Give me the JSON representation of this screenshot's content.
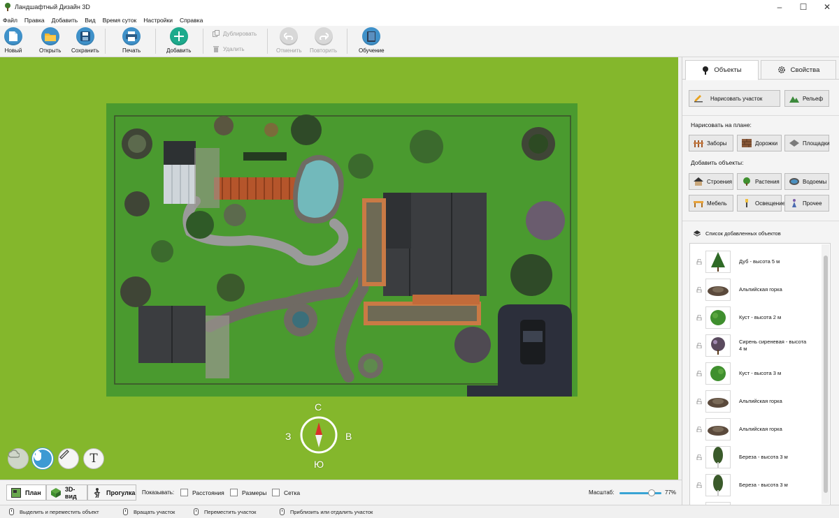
{
  "window": {
    "title": "Ландшафтный Дизайн 3D",
    "controls": [
      "–",
      "☐",
      "✕"
    ]
  },
  "menu": [
    "Файл",
    "Правка",
    "Добавить",
    "Вид",
    "Время суток",
    "Настройки",
    "Справка"
  ],
  "toolbar": {
    "new": "Новый",
    "open": "Открыть",
    "save": "Сохранить",
    "print": "Печать",
    "add": "Добавить",
    "duplicate": "Дублировать",
    "delete": "Удалить",
    "undo": "Отменить",
    "redo": "Повторить",
    "learn": "Обучение"
  },
  "compass": {
    "north": "С",
    "south": "Ю",
    "west": "З",
    "east": "В"
  },
  "tools": {
    "text_tool_glyph": "T"
  },
  "panel": {
    "tab_objects": "Объекты",
    "tab_properties": "Свойства",
    "draw_plot": "Нарисовать участок",
    "relief": "Рельеф",
    "draw_on_plan": "Нарисовать на плане:",
    "fences": "Заборы",
    "paths": "Дорожки",
    "platforms": "Площадки",
    "add_objects": "Добавить объекты:",
    "buildings": "Строения",
    "plants": "Растения",
    "ponds": "Водоемы",
    "furniture": "Мебель",
    "lighting": "Освещение",
    "other": "Прочее",
    "list_title": "Список добавленных объектов",
    "objects": [
      {
        "name": "Дуб - высота 5 м",
        "icon": "tree-icon"
      },
      {
        "name": "Альпийская горка",
        "icon": "rock-garden-icon"
      },
      {
        "name": "Куст - высота 2 м",
        "icon": "bush-icon"
      },
      {
        "name": "Сирень сиреневая - высота 4 м",
        "icon": "lilac-icon"
      },
      {
        "name": "Куст - высота 3 м",
        "icon": "bush-icon"
      },
      {
        "name": "Альпийская горка",
        "icon": "rock-garden-icon"
      },
      {
        "name": "Альпийская горка",
        "icon": "rock-garden-icon"
      },
      {
        "name": "Береза - высота 3 м",
        "icon": "birch-icon"
      },
      {
        "name": "Береза - высота 3 м",
        "icon": "birch-icon"
      }
    ]
  },
  "viewbar": {
    "plan": "План",
    "view3d": "3D-вид",
    "walk": "Прогулка",
    "show": "Показывать:",
    "distances": "Расстояния",
    "sizes": "Размеры",
    "grid": "Сетка",
    "scale_label": "Масштаб:",
    "scale_value": "77%",
    "scale_fraction": 0.77
  },
  "status": {
    "select_move": "Выделить и переместить объект",
    "rotate": "Вращать участок",
    "move_plot": "Переместить участок",
    "zoom": "Приблизить или отдалить участок"
  },
  "colors": {
    "accent": "#3f91c9",
    "lawn": "#84b72c",
    "plot": "#4a9a2f"
  }
}
